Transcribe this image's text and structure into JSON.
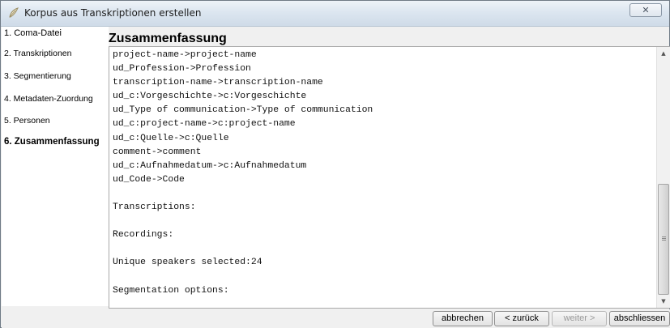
{
  "window": {
    "title": "Korpus aus Transkriptionen erstellen"
  },
  "sidebar": {
    "items": [
      {
        "label": "1. Coma-Datei"
      },
      {
        "label": "2. Transkriptionen"
      },
      {
        "label": "3. Segmentierung"
      },
      {
        "label": "4. Metadaten-Zuordung"
      },
      {
        "label": "5. Personen"
      },
      {
        "label": "6. Zusammenfassung",
        "active": true
      }
    ]
  },
  "main": {
    "heading": "Zusammenfassung",
    "lines": [
      "project-name->project-name",
      "ud_Profession->Profession",
      "transcription-name->transcription-name",
      "ud_c:Vorgeschichte->c:Vorgeschichte",
      "ud_Type of communication->Type of communication",
      "ud_c:project-name->c:project-name",
      "ud_c:Quelle->c:Quelle",
      "comment->comment",
      "ud_c:Aufnahmedatum->c:Aufnahmedatum",
      "ud_Code->Code",
      "",
      "Transcriptions:",
      "",
      "Recordings:",
      "",
      "Unique speakers selected:24",
      "",
      "Segmentation options:"
    ]
  },
  "footer": {
    "cancel_label": "abbrechen",
    "back_label": "< zurück",
    "next_label": "weiter >",
    "finish_label": "abschliessen"
  },
  "colors": {
    "titlebar": "#dce6f0",
    "sidebar_bg": "#ffffff",
    "window_bg": "#f0f0f0"
  }
}
